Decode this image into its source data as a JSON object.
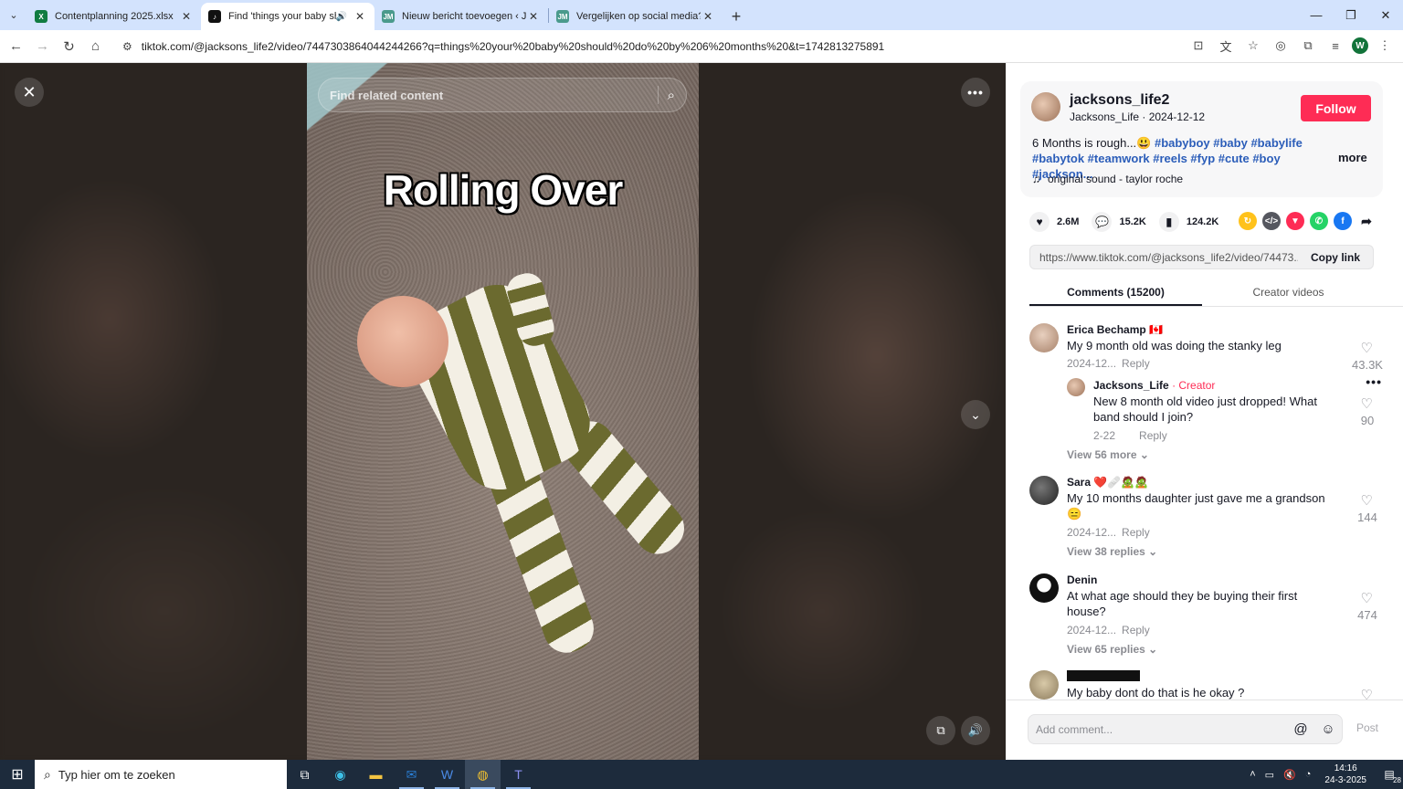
{
  "browser": {
    "tabs": [
      {
        "title": "Contentplanning 2025.xlsx",
        "icon": "excel-icon",
        "color": "#107c41",
        "active": false
      },
      {
        "title": "Find 'things your baby shou",
        "icon": "tiktok-icon",
        "color": "#111111",
        "active": true
      },
      {
        "title": "Nieuw bericht toevoegen ‹ J/M",
        "icon": "jm-icon",
        "color": "#4a9a8c",
        "active": false
      },
      {
        "title": "Vergelijken op social media? Zo",
        "icon": "jm-icon",
        "color": "#4a9a8c",
        "active": false
      }
    ],
    "url": "tiktok.com/@jacksons_life2/video/7447303864044244266?q=things%20your%20baby%20should%20do%20by%206%20months%20&t=1742813275891",
    "profile_initial": "W"
  },
  "video": {
    "search_placeholder": "Find related content",
    "overlay_title": "Rolling Over"
  },
  "author": {
    "username": "jacksons_life2",
    "nickname_date": "Jacksons_Life · 2024-12-12",
    "follow_label": "Follow",
    "description_text": "6 Months is rough...😃 ",
    "hashtags": "#babyboy #baby #babylife #babytok #teamwork #reels #fyp #cute #boy #jackson...",
    "more_label": "more",
    "music": "original sound - taylor roche"
  },
  "stats": {
    "likes": "2.6M",
    "comments": "15.2K",
    "saves": "124.2K"
  },
  "share": {
    "link": "https://www.tiktok.com/@jacksons_life2/video/74473...",
    "copy_label": "Copy link"
  },
  "panel_tabs": {
    "comments": "Comments (15200)",
    "creator_videos": "Creator videos"
  },
  "comments": [
    {
      "name": "Erica Bechamp 🇨🇦",
      "text": "My 9 month old was doing the stanky leg",
      "date": "2024-12...",
      "reply": "Reply",
      "likes": "43.3K"
    },
    {
      "name": "Sara ❤️🩹🧟🧟",
      "text": "My 10 months daughter just gave me a grandson 😑",
      "date": "2024-12...",
      "reply": "Reply",
      "likes": "144",
      "view_more": "View 38 replies"
    },
    {
      "name": "Denin",
      "text": "At what age should they be buying their first house?",
      "date": "2024-12...",
      "reply": "Reply",
      "likes": "474",
      "view_more": "View 65 replies"
    },
    {
      "name": "",
      "text": "My baby dont do that is he okay ?",
      "likes": ""
    }
  ],
  "creator_reply": {
    "name": "Jacksons_Life",
    "tag": "· Creator",
    "text": "New 8 month old video just dropped! What band should I join?",
    "date": "2-22",
    "reply": "Reply",
    "likes": "90",
    "view_more": "View 56 more"
  },
  "comment_bar": {
    "placeholder": "Add comment...",
    "post_label": "Post"
  },
  "taskbar": {
    "search_placeholder": "Typ hier om te zoeken",
    "time": "14:16",
    "date": "24-3-2025",
    "notifications": "28"
  }
}
